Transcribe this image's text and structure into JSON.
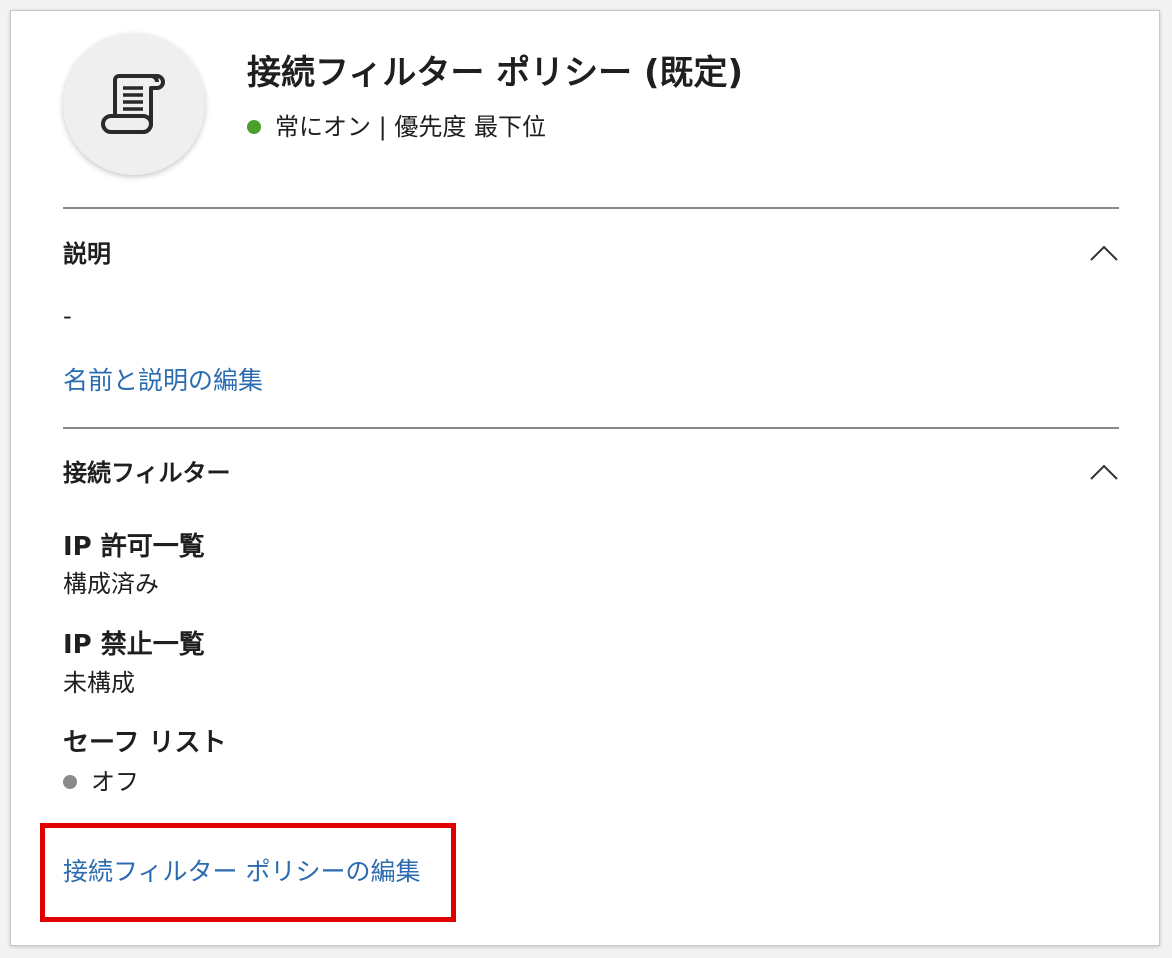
{
  "header": {
    "icon": "scroll-icon",
    "title": "接続フィルター ポリシー (既定)",
    "status_text": "常にオン | 優先度 最下位",
    "status_color": "#4aa02c"
  },
  "description_section": {
    "heading": "説明",
    "value": "-",
    "edit_link": "名前と説明の編集"
  },
  "connection_filter_section": {
    "heading": "接続フィルター",
    "items": [
      {
        "label": "IP 許可一覧",
        "value": "構成済み"
      },
      {
        "label": "IP 禁止一覧",
        "value": "未構成"
      },
      {
        "label": "セーフ リスト",
        "value": "オフ"
      }
    ],
    "safe_list_status_color": "#8a8a8a",
    "edit_link": "接続フィルター ポリシーの編集"
  },
  "colors": {
    "link": "#2b6cb0",
    "highlight": "#e00000"
  }
}
